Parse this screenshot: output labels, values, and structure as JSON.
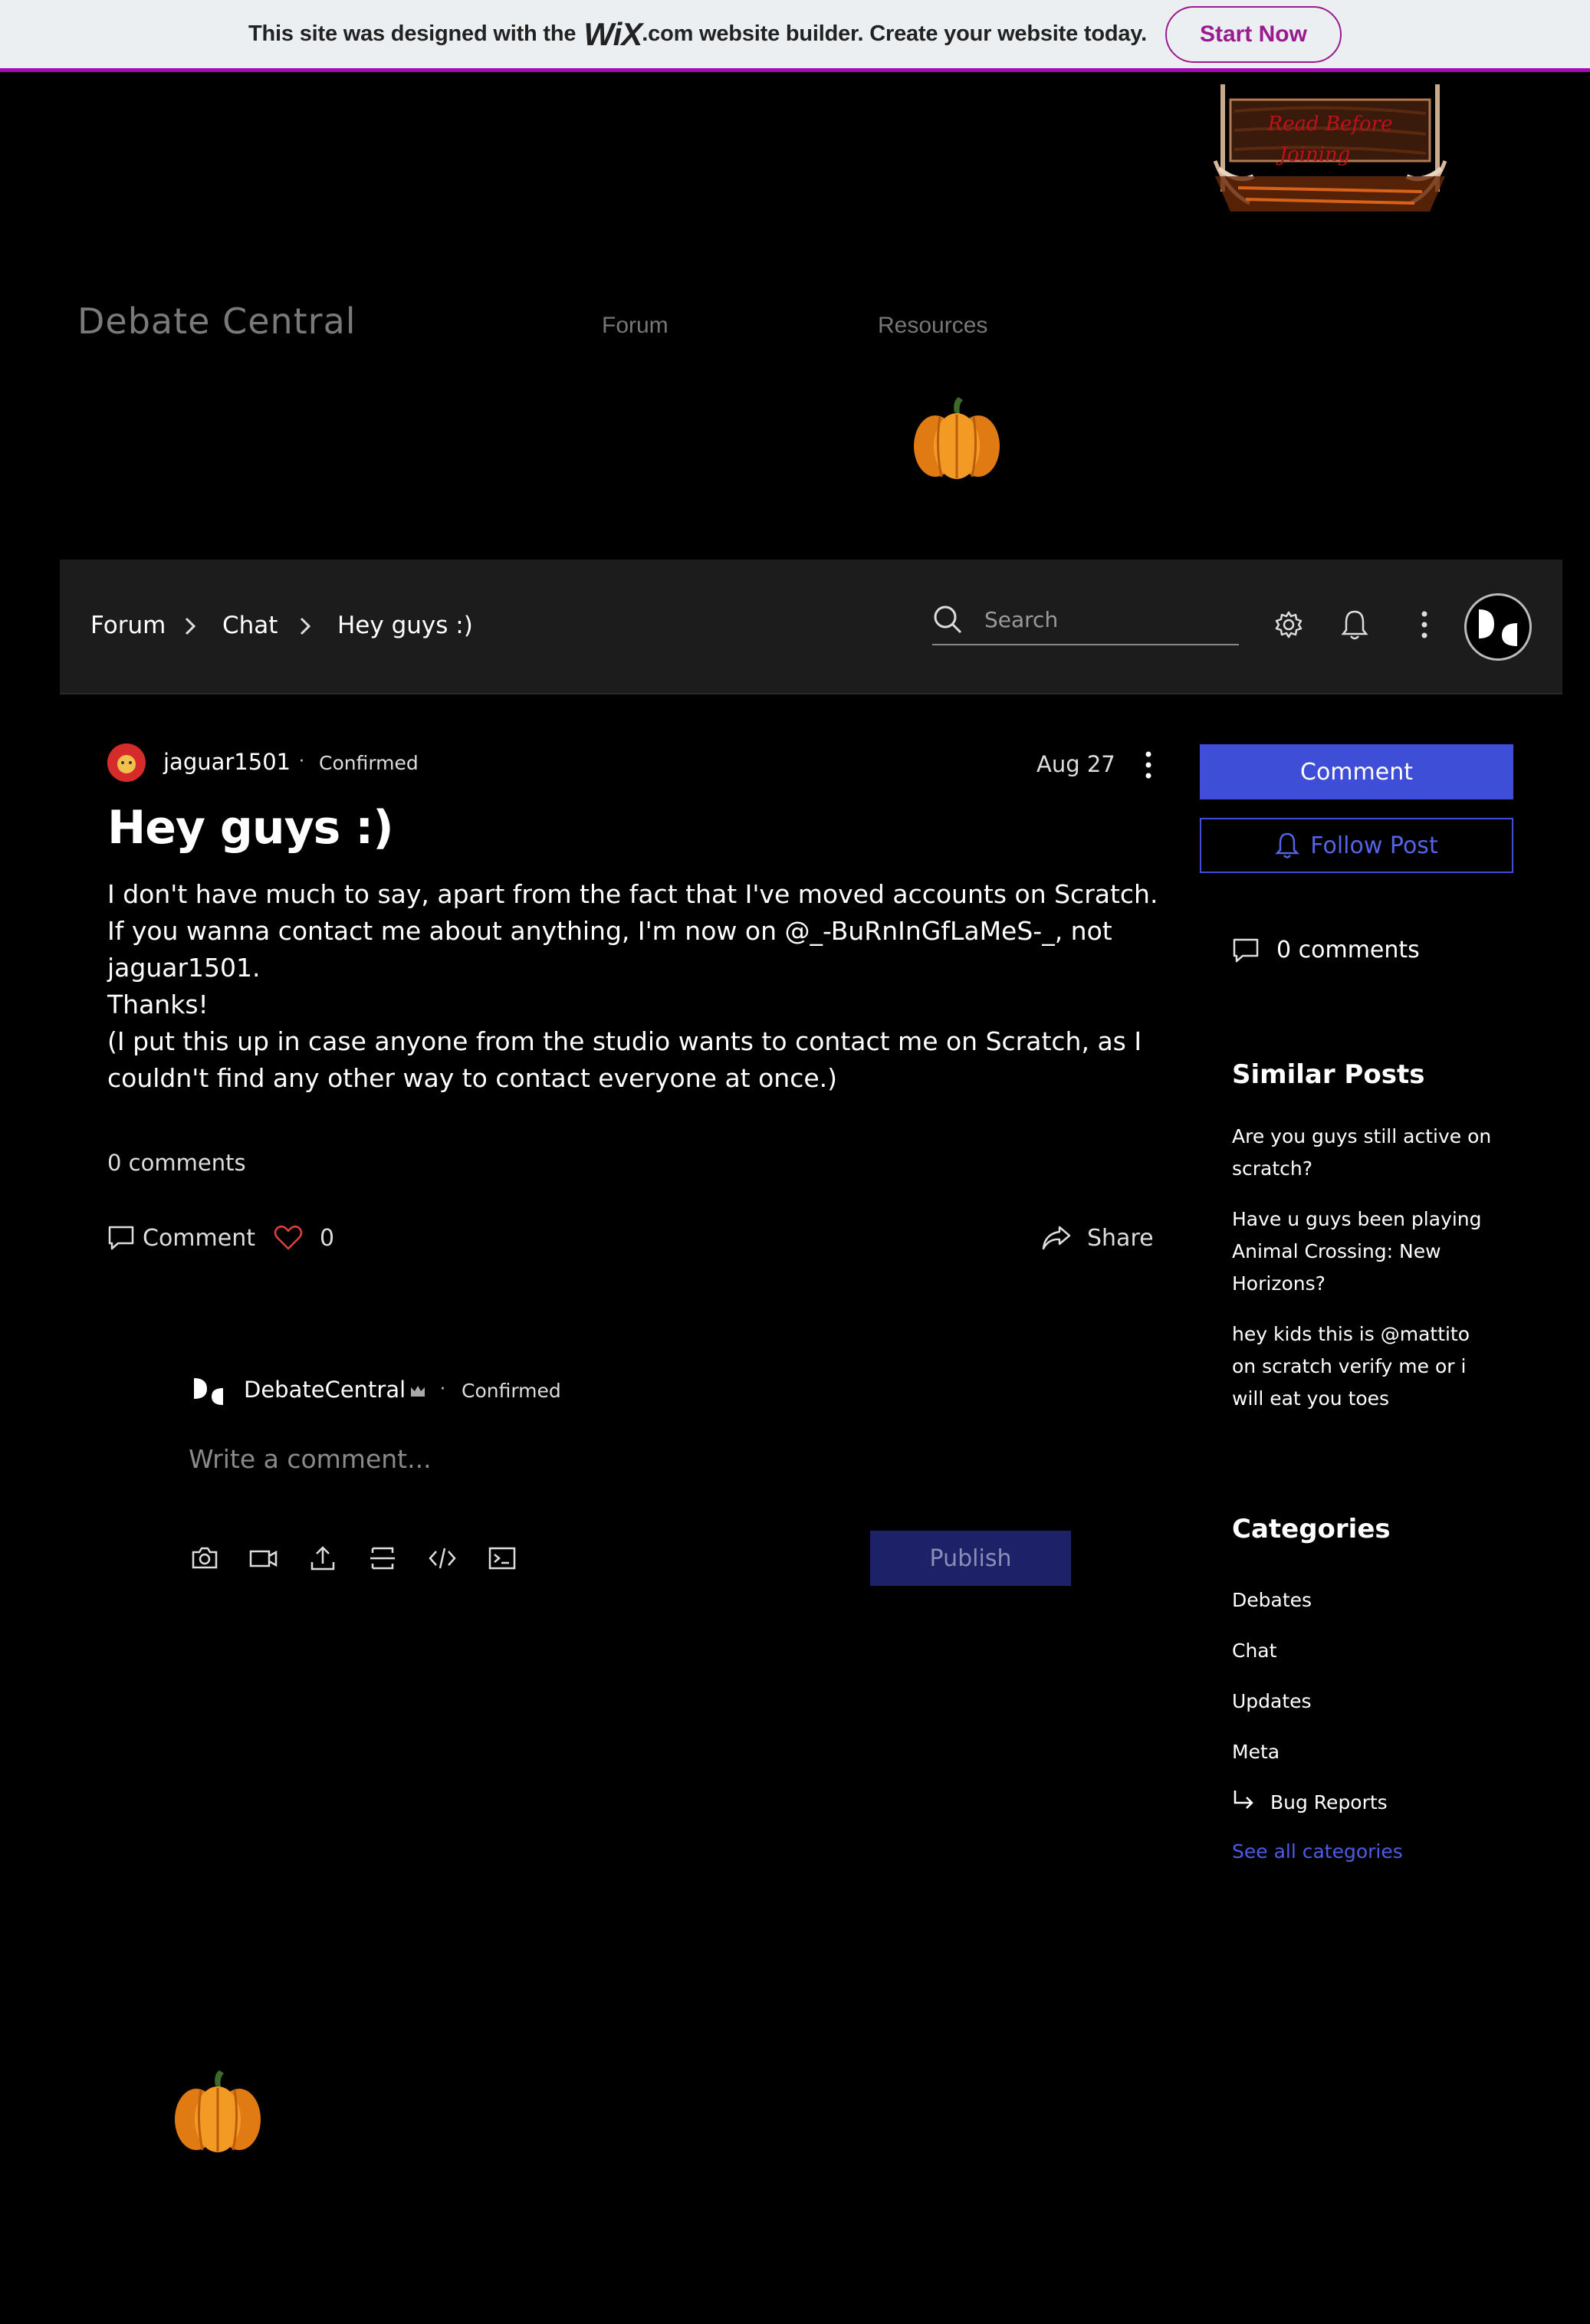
{
  "wix_banner": {
    "text_before": "This site was designed with the",
    "logo": "WiX",
    "text_after": ".com website builder. Create your website today.",
    "button_label": "Start Now",
    "accent": "#a70ab3"
  },
  "header": {
    "sign_text": [
      "Read Before",
      "Joining"
    ],
    "site_title": "Debate Central",
    "nav": [
      "Forum",
      "Resources"
    ],
    "decoration_icon": "pumpkin-icon"
  },
  "forum_bar": {
    "breadcrumbs": [
      "Forum",
      "Chat",
      "Hey guys :)"
    ],
    "search_placeholder": "Search",
    "icons": [
      "settings-icon",
      "bell-icon",
      "more-icon",
      "avatar"
    ]
  },
  "post": {
    "author": "jaguar1501",
    "author_badge": "Confirmed",
    "date": "Aug 27",
    "title": "Hey guys :)",
    "body": [
      "I don't have much to say, apart from the fact that I've moved accounts on Scratch.",
      "If you wanna contact me about anything, I'm now on @_-BuRnInGfLaMeS-_, not",
      "jaguar1501.",
      "Thanks!",
      "(I put this up in case anyone from the studio wants to contact me on Scratch, as I",
      "couldn't find any other way to contact everyone at once.)"
    ],
    "comments_count": "0 comments",
    "actions": {
      "comment": "Comment",
      "likes": "0",
      "share": "Share"
    }
  },
  "composer": {
    "user": "DebateCentral",
    "user_badge": "Confirmed",
    "placeholder": "Write a comment...",
    "tools": [
      "camera-icon",
      "video-icon",
      "upload-icon",
      "divider-icon",
      "code-icon",
      "embed-icon"
    ],
    "publish_label": "Publish"
  },
  "sidebar": {
    "comment_button": "Comment",
    "follow_button": "Follow Post",
    "comments": "0 comments",
    "similar_heading": "Similar Posts",
    "similar_posts": [
      "Are you guys still active on scratch?",
      "Have u guys been playing Animal Crossing: New Horizons?",
      "hey kids this is @mattito on scratch verify me or i will eat you toes"
    ],
    "categories_heading": "Categories",
    "categories": [
      "Debates",
      "Chat",
      "Updates",
      "Meta",
      "Bug Reports"
    ],
    "see_all": "See all categories",
    "accent": "#3f4ed6"
  }
}
